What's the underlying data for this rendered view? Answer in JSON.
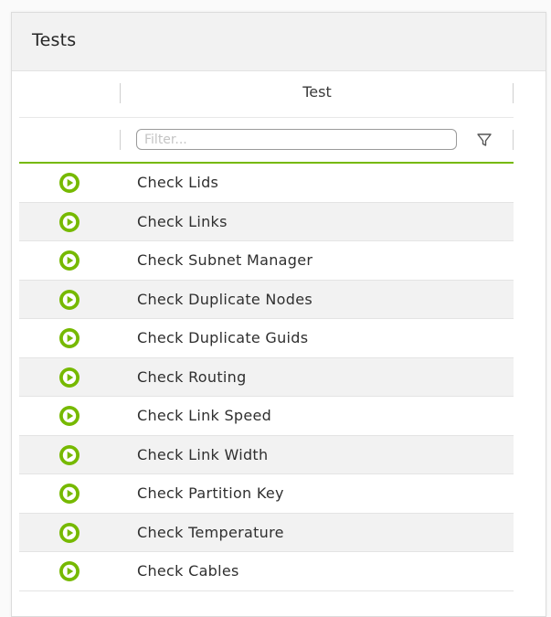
{
  "panel": {
    "title": "Tests"
  },
  "table": {
    "column_header": "Test",
    "filter_placeholder": "Filter...",
    "rows": [
      {
        "label": "Check Lids"
      },
      {
        "label": "Check Links"
      },
      {
        "label": "Check Subnet Manager"
      },
      {
        "label": "Check Duplicate Nodes"
      },
      {
        "label": "Check Duplicate Guids"
      },
      {
        "label": "Check Routing"
      },
      {
        "label": "Check Link Speed"
      },
      {
        "label": "Check Link Width"
      },
      {
        "label": "Check Partition Key"
      },
      {
        "label": "Check Temperature"
      },
      {
        "label": "Check Cables"
      }
    ]
  },
  "icons": {
    "run": "play-circle-icon",
    "filter": "funnel-icon"
  },
  "colors": {
    "accent": "#76b900",
    "row_alt": "#f2f2f2"
  }
}
